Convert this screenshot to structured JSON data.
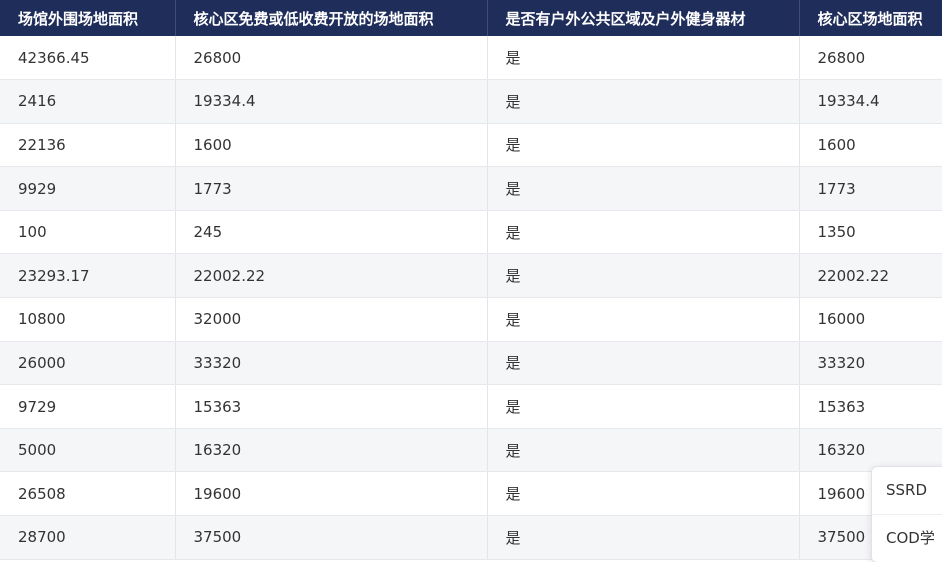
{
  "table": {
    "headers": [
      "场馆外围场地面积",
      "核心区免费或低收费开放的场地面积",
      "是否有户外公共区域及户外健身器材",
      "核心区场地面积"
    ],
    "rows": [
      [
        "42366.45",
        "26800",
        "是",
        "26800"
      ],
      [
        "2416",
        "19334.4",
        "是",
        "19334.4"
      ],
      [
        "22136",
        "1600",
        "是",
        "1600"
      ],
      [
        "9929",
        "1773",
        "是",
        "1773"
      ],
      [
        "100",
        "245",
        "是",
        "1350"
      ],
      [
        "23293.17",
        "22002.22",
        "是",
        "22002.22"
      ],
      [
        "10800",
        "32000",
        "是",
        "16000"
      ],
      [
        "26000",
        "33320",
        "是",
        "33320"
      ],
      [
        "9729",
        "15363",
        "是",
        "15363"
      ],
      [
        "5000",
        "16320",
        "是",
        "16320"
      ],
      [
        "26508",
        "19600",
        "是",
        "19600"
      ],
      [
        "28700",
        "37500",
        "是",
        "37500"
      ]
    ]
  },
  "float_menu": {
    "items": [
      "SSRD",
      "COD学"
    ]
  }
}
